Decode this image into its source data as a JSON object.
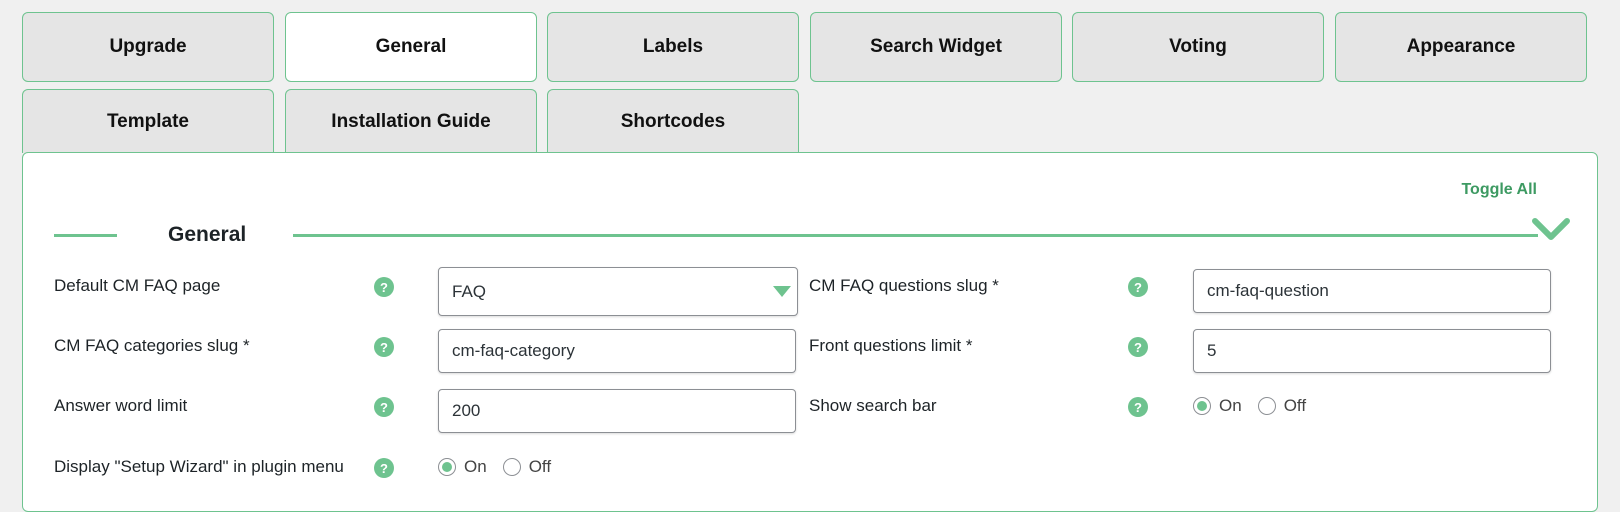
{
  "tabs": [
    {
      "label": "Upgrade",
      "active": false
    },
    {
      "label": "General",
      "active": true
    },
    {
      "label": "Labels",
      "active": false
    },
    {
      "label": "Search Widget",
      "active": false
    },
    {
      "label": "Voting",
      "active": false
    },
    {
      "label": "Appearance",
      "active": false
    },
    {
      "label": "Template",
      "active": false
    },
    {
      "label": "Installation Guide",
      "active": false
    },
    {
      "label": "Shortcodes",
      "active": false
    }
  ],
  "panel": {
    "toggle_all": "Toggle All",
    "section_title": "General",
    "help_glyph": "?"
  },
  "fields": {
    "default_page": {
      "label": "Default CM FAQ page",
      "value": "FAQ"
    },
    "questions_slug": {
      "label": "CM FAQ questions slug *",
      "value": "cm-faq-question"
    },
    "categories_slug": {
      "label": "CM FAQ categories slug *",
      "value": "cm-faq-category"
    },
    "front_limit": {
      "label": "Front questions limit *",
      "value": "5"
    },
    "answer_limit": {
      "label": "Answer word limit",
      "value": "200"
    },
    "search_bar": {
      "label": "Show search bar",
      "on": "On",
      "off": "Off",
      "selected": "On"
    },
    "setup_wizard": {
      "label": "Display \"Setup Wizard\" in plugin menu",
      "on": "On",
      "off": "Off",
      "selected": "On"
    }
  },
  "colors": {
    "accent": "#6ec38f",
    "accent_text": "#3d9a62",
    "tab_bg": "#e5e5e5",
    "page_bg": "#f0f0f0"
  }
}
